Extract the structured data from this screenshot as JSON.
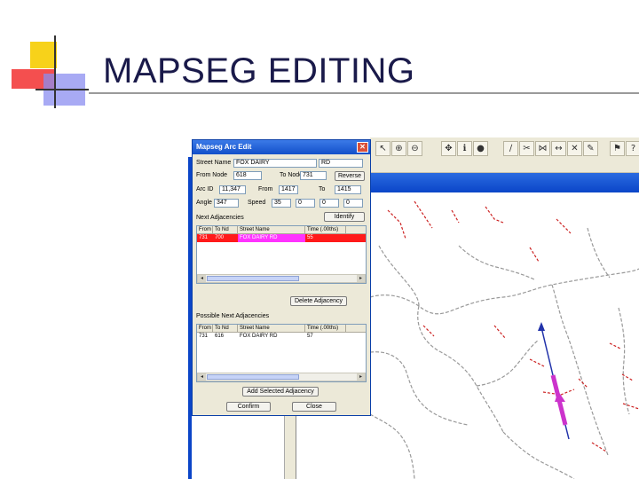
{
  "slide": {
    "title": "MAPSEG EDITING"
  },
  "dialog": {
    "title": "Mapseg Arc Edit",
    "street_name_label": "Street Name",
    "street_name_value": "FOX DAIRY",
    "street_suffix": "RD",
    "from_node_label": "From Node",
    "from_node_value": "618",
    "to_node_label": "To Node",
    "to_node_value": "731",
    "reverse_button": "Reverse",
    "arc_id_label": "Arc ID",
    "arc_id_value": "11,347",
    "from_label": "From",
    "from_value": "1417",
    "to_label": "To",
    "to_value": "1415",
    "angle_label": "Angle",
    "angle_value": "347",
    "speed_label": "Speed",
    "speed_value": "35",
    "speed_extra": [
      "0",
      "0",
      "0"
    ],
    "next_adj_label": "Next Adjacencies",
    "identify_button": "Identify",
    "columns": [
      "From Nd",
      "To Nd",
      "Street Name",
      "Time (.00ths)"
    ],
    "next_adj_rows": [
      {
        "from": "731",
        "to": "700",
        "street": "FOX DAIRY RD",
        "time": "55"
      }
    ],
    "delete_adj_button": "Delete Adjacency",
    "possible_adj_label": "Possible Next Adjacencies",
    "possible_adj_rows": [
      {
        "from": "731",
        "to": "616",
        "street": "FOX DAIRY RD",
        "time": "57"
      }
    ],
    "add_adj_button": "Add Selected Adjacency",
    "confirm_button": "Confirm",
    "close_button": "Close"
  },
  "toolbar": {
    "icons": [
      "select-icon",
      "zoom-in-icon",
      "zoom-out-icon",
      "pan-icon",
      "identify-icon",
      "node-icon",
      "arc-icon",
      "split-icon",
      "join-icon",
      "move-icon",
      "delete-icon",
      "edit-icon",
      "flag-icon",
      "measure-icon",
      "help-icon"
    ],
    "glyphs": [
      "↖",
      "⊕",
      "⊖",
      "✥",
      "ℹ",
      "●",
      "∕",
      "✂",
      "⋈",
      "↔",
      "✕",
      "✎",
      "⚑",
      "📏",
      "?"
    ]
  },
  "colors": {
    "title_text": "#1a1a4a",
    "dialog_border": "#0a3fa8",
    "selected_row": "#ff1a1a",
    "selected_street": "#ff33ff",
    "map_road": "#999999",
    "map_red_segments": "#cc2222",
    "selected_arc": "#cc33cc",
    "arc_direction": "#2233aa"
  }
}
